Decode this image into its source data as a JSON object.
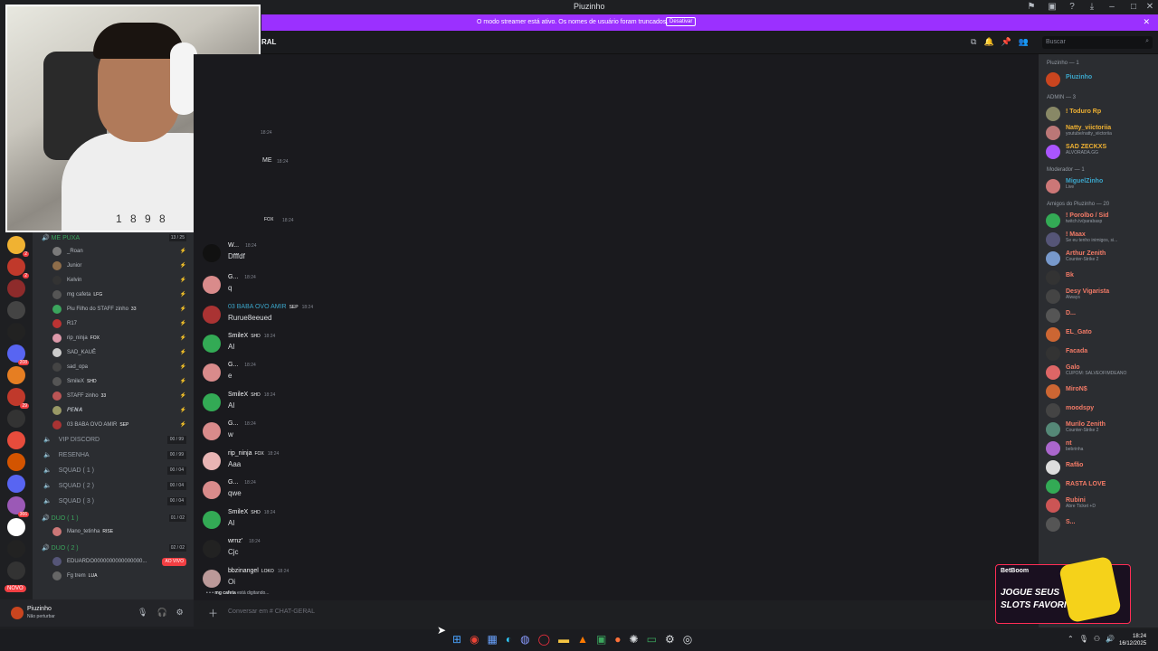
{
  "window": {
    "title": "Piuzinho"
  },
  "banner": {
    "message": "O modo streamer está ativo. Os nomes de usuário foram truncados.",
    "button": "Desativar"
  },
  "header": {
    "channel_name": "RAL",
    "search_placeholder": "Buscar"
  },
  "webcam": {
    "shirt_text": "1 8 9 8"
  },
  "servers": [
    {
      "color": "#f0b232",
      "badge": "2"
    },
    {
      "color": "#c0392b",
      "badge": "2"
    },
    {
      "color": "#8e2b2b",
      "badge": ""
    },
    {
      "color": "#444",
      "badge": ""
    },
    {
      "color": "#222",
      "badge": ""
    },
    {
      "color": "#5865f2",
      "badge": "208"
    },
    {
      "color": "#e67e22",
      "badge": ""
    },
    {
      "color": "#c0392b",
      "badge": "29"
    },
    {
      "color": "#333",
      "badge": ""
    },
    {
      "color": "#e74c3c",
      "badge": ""
    },
    {
      "color": "#d35400",
      "badge": ""
    },
    {
      "color": "#5865f2",
      "badge": ""
    },
    {
      "color": "#9b59b6",
      "badge": "366"
    },
    {
      "color": "#fff",
      "badge": ""
    },
    {
      "color": "#222",
      "badge": ""
    },
    {
      "color": "#333",
      "badge": ""
    }
  ],
  "novo_label": "NOVO",
  "sidebar": {
    "category_me_puxa": {
      "label": "ME PUXA",
      "count": "13 / 25"
    },
    "voice_users": [
      {
        "name": "_Roan",
        "tag": "",
        "color": "#7a7a7a"
      },
      {
        "name": "Junior",
        "tag": "",
        "color": "#8e6d4a"
      },
      {
        "name": "Kelvin",
        "tag": "",
        "color": "#333"
      },
      {
        "name": "mg cafeta",
        "tag": "LFG",
        "color": "#555"
      },
      {
        "name": "Piu Filho do STAFF zinho",
        "tag": "33",
        "color": "#3ba55d"
      },
      {
        "name": "R17",
        "tag": "",
        "color": "#b33"
      },
      {
        "name": "rip_ninja",
        "tag": "FOX",
        "color": "#d9a"
      },
      {
        "name": "SAD_KAUÊ",
        "tag": "",
        "color": "#ccc"
      },
      {
        "name": "sad_opa",
        "tag": "",
        "color": "#444"
      },
      {
        "name": "SmileX",
        "tag": "SHD",
        "color": "#555"
      },
      {
        "name": "STAFF zinho",
        "tag": "33",
        "color": "#b55"
      },
      {
        "name": "𝑷𝑬𝑵𝑨",
        "tag": "",
        "color": "#996"
      },
      {
        "name": "03 BABA OVO AMIR",
        "tag": "SEP",
        "color": "#a33"
      }
    ],
    "channels": [
      {
        "name": "VIP DISCORD",
        "count": "00 / 99"
      },
      {
        "name": "RESENHA",
        "count": "00 / 99"
      },
      {
        "name": "SQUAD ( 1 )",
        "count": "00 / 04"
      },
      {
        "name": "SQUAD ( 2 )",
        "count": "00 / 04"
      },
      {
        "name": "SQUAD ( 3 )",
        "count": "00 / 04"
      }
    ],
    "duo1": {
      "label": "DUO ( 1 )",
      "count": "01 / 02",
      "user": "Mano_tetinha",
      "tag": "RISE"
    },
    "duo2": {
      "label": "DUO ( 2 )",
      "count": "02 / 02",
      "user1": "EDUARDO0000000000000000...",
      "live": "AO VIVO",
      "user2": "Fg trem",
      "tag2": "LUA"
    }
  },
  "user_panel": {
    "name": "Piuzinho",
    "status": "Não perturbar"
  },
  "chat": {
    "snippets": [
      {
        "text": "18:24"
      },
      {
        "text": "ME"
      },
      {
        "text": "18:24"
      },
      {
        "text": "FOX"
      },
      {
        "text": "18:24"
      }
    ],
    "messages": [
      {
        "author": "W...",
        "tag": "",
        "time": "18:24",
        "body": "Dfffdf",
        "color": "#111"
      },
      {
        "author": "G...",
        "tag": "",
        "time": "18:24",
        "body": "q",
        "color": "#d98b8b"
      },
      {
        "author": "03 BABA OVO AMIR",
        "tag": "SEP",
        "time": "18:24",
        "body": "Rurue8eeued",
        "color": "#a33"
      },
      {
        "author": "SmileX",
        "tag": "SHD",
        "time": "18:24",
        "body": "Al",
        "color": "#3a5"
      },
      {
        "author": "G...",
        "tag": "",
        "time": "18:24",
        "body": "e",
        "color": "#d98b8b"
      },
      {
        "author": "SmileX",
        "tag": "SHD",
        "time": "18:24",
        "body": "Al",
        "color": "#3a5"
      },
      {
        "author": "G...",
        "tag": "",
        "time": "18:24",
        "body": "w",
        "color": "#d98b8b"
      },
      {
        "author": "rip_ninja",
        "tag": "FOX",
        "time": "18:24",
        "body": "Aaa",
        "color": "#e8b4b4"
      },
      {
        "author": "G...",
        "tag": "",
        "time": "18:24",
        "body": "qwe",
        "color": "#d98b8b"
      },
      {
        "author": "SmileX",
        "tag": "SHD",
        "time": "18:24",
        "body": "Al",
        "color": "#3a5"
      },
      {
        "author": "wrnz'",
        "tag": "",
        "time": "18:24",
        "body": "Cjc",
        "color": "#222"
      },
      {
        "author": "bbzinangel",
        "tag": "LOKO",
        "time": "18:24",
        "body": "Oi",
        "color": "#b99"
      }
    ],
    "typing_user": "mg cafeta",
    "typing_text": "está digitando...",
    "composer_placeholder": "Conversar em #",
    "composer_channel": "CHAT-GERAL"
  },
  "members": {
    "groups": [
      {
        "header": "Piuzinho — 1",
        "items": [
          {
            "name": "Piuzinho",
            "sub": "",
            "color": "#3ba5c9",
            "av": "#c9451f"
          }
        ]
      },
      {
        "header": "ADMIN — 3",
        "items": [
          {
            "name": "! Toduro Rp",
            "sub": "",
            "color": "#f0b232",
            "av": "#886"
          },
          {
            "name": "Natty_viictoriia",
            "sub": "youtube/natty_viictoriia",
            "color": "#f0b232",
            "av": "#b77"
          },
          {
            "name": "SAD ZECKXS",
            "sub": "ALVORADA.GG",
            "color": "#f0b232",
            "av": "#a5f"
          }
        ]
      },
      {
        "header": "Moderador — 1",
        "items": [
          {
            "name": "MiguelZinho",
            "sub": "Live",
            "color": "#3ba5c9",
            "av": "#c77"
          }
        ]
      },
      {
        "header": "Amigos do Piuzinho — 20",
        "items": [
          {
            "name": "! Porolbo / Sid",
            "sub": "twitch.tv/parabasp",
            "color": "#f47b67",
            "av": "#3a5"
          },
          {
            "name": "! Maax",
            "sub": "Se eu tenho inimigos, si...",
            "color": "#f47b67",
            "av": "#557"
          },
          {
            "name": "Arthur Zenith",
            "sub": "Counter-Strike 2",
            "color": "#f47b67",
            "av": "#79c"
          },
          {
            "name": "Bk",
            "sub": "",
            "color": "#f47b67",
            "av": "#333"
          },
          {
            "name": "Desy Vigarista",
            "sub": "Always",
            "color": "#f47b67",
            "av": "#444"
          },
          {
            "name": "D...",
            "sub": "",
            "color": "#f47b67",
            "av": "#555"
          },
          {
            "name": "EL_Gato",
            "sub": "",
            "color": "#f47b67",
            "av": "#c63"
          },
          {
            "name": "Facada",
            "sub": "",
            "color": "#f47b67",
            "av": "#333"
          },
          {
            "name": "Galo",
            "sub": "CUPOM: SALVEOFIMDEANO",
            "color": "#f47b67",
            "av": "#d66"
          },
          {
            "name": "MiroN$",
            "sub": "",
            "color": "#f47b67",
            "av": "#c63"
          },
          {
            "name": "moodspy",
            "sub": "",
            "color": "#f47b67",
            "av": "#444"
          },
          {
            "name": "Murilo Zenith",
            "sub": "Counter-Strike 2",
            "color": "#f47b67",
            "av": "#587"
          },
          {
            "name": "nt",
            "sub": "bebrinha",
            "color": "#f47b67",
            "av": "#a6c"
          },
          {
            "name": "Rafão",
            "sub": "",
            "color": "#f47b67",
            "av": "#ddd"
          },
          {
            "name": "RASTA LOVE",
            "sub": "",
            "color": "#f47b67",
            "av": "#3a5"
          },
          {
            "name": "Rubini",
            "sub": "Abre Ticket +D",
            "color": "#f47b67",
            "av": "#c55"
          },
          {
            "name": "S...",
            "sub": "",
            "color": "#f47b67",
            "av": "#555"
          }
        ]
      }
    ]
  },
  "ad": {
    "brand": "BetBoom",
    "line1": "JOGUE SEUS",
    "line2": "SLOTS FAVORITO"
  },
  "taskbar": {
    "time": "18:24",
    "date": "16/12/2025"
  }
}
